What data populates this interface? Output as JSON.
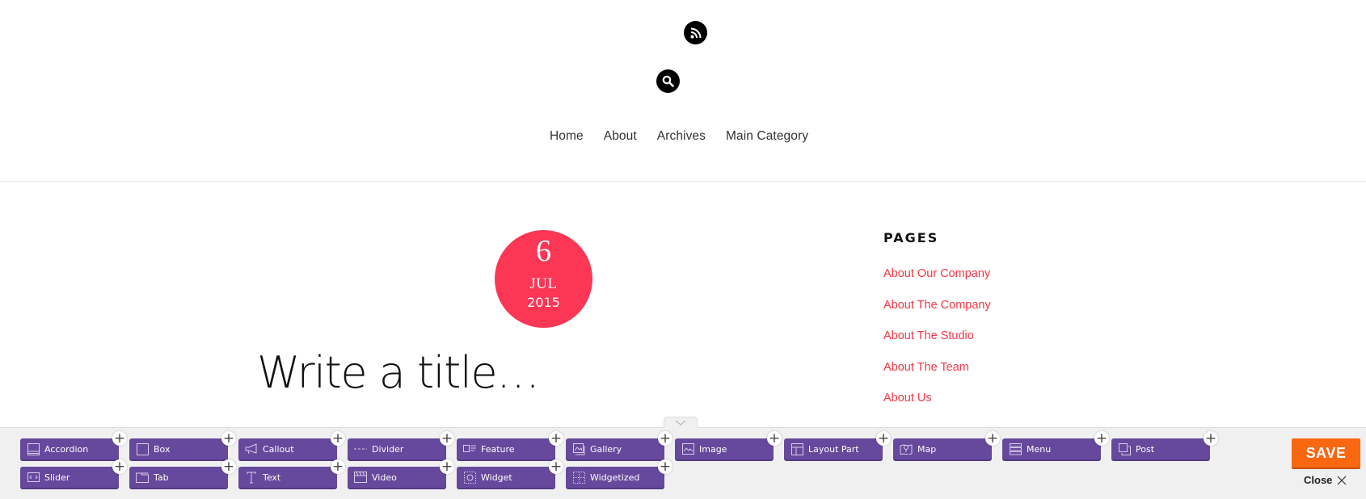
{
  "header": {
    "icons": [
      "rss-icon",
      "search-icon"
    ],
    "nav": [
      {
        "label": "Home"
      },
      {
        "label": "About"
      },
      {
        "label": "Archives"
      },
      {
        "label": "Main Category"
      }
    ]
  },
  "post": {
    "date": {
      "day": "6",
      "month": "JUL",
      "year": "2015"
    },
    "title_placeholder": "Write a title…",
    "accent_color": "#fc3655"
  },
  "sidebar": {
    "title": "PAGES",
    "links": [
      {
        "label": "About Our Company"
      },
      {
        "label": "About The Company"
      },
      {
        "label": "About The Studio"
      },
      {
        "label": "About The Team"
      },
      {
        "label": "About Us"
      }
    ],
    "link_color": "#f43746"
  },
  "builder": {
    "module_color": "#66489c",
    "modules": [
      {
        "label": "Accordion",
        "icon": "accordion-icon"
      },
      {
        "label": "Box",
        "icon": "box-icon"
      },
      {
        "label": "Callout",
        "icon": "megaphone-icon"
      },
      {
        "label": "Divider",
        "icon": "divider-icon"
      },
      {
        "label": "Feature",
        "icon": "feature-icon"
      },
      {
        "label": "Gallery",
        "icon": "gallery-icon"
      },
      {
        "label": "Image",
        "icon": "image-icon"
      },
      {
        "label": "Layout Part",
        "icon": "layout-icon"
      },
      {
        "label": "Map",
        "icon": "map-icon"
      },
      {
        "label": "Menu",
        "icon": "menu-icon"
      },
      {
        "label": "Post",
        "icon": "post-icon"
      },
      {
        "label": "Slider",
        "icon": "slider-icon"
      },
      {
        "label": "Tab",
        "icon": "tab-icon"
      },
      {
        "label": "Text",
        "icon": "text-icon"
      },
      {
        "label": "Video",
        "icon": "video-icon"
      },
      {
        "label": "Widget",
        "icon": "widget-icon"
      },
      {
        "label": "Widgetized",
        "icon": "widgetized-icon"
      }
    ],
    "add_symbol": "+",
    "save_label": "SAVE",
    "save_color": "#f96711",
    "close_label": "Close"
  }
}
